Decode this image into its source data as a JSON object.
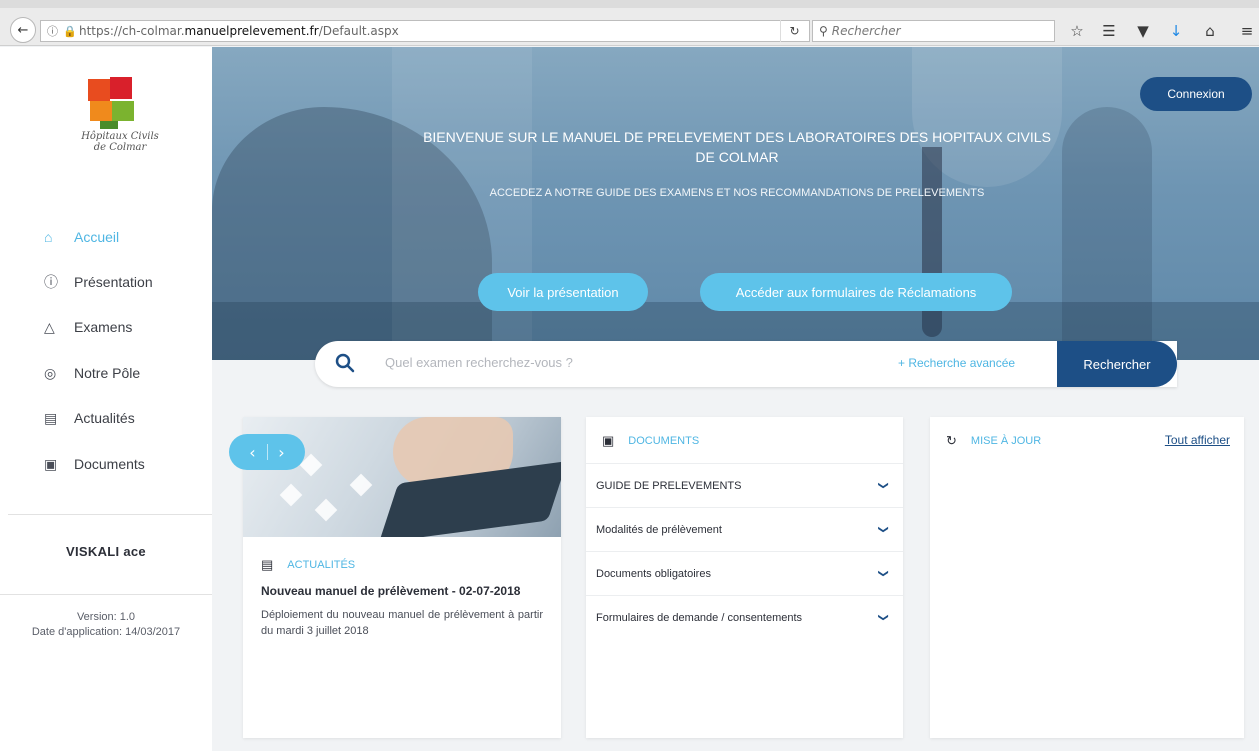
{
  "browser": {
    "url_prefix": "https://ch-colmar.",
    "url_domain": "manuelprelevement.fr",
    "url_path": "/Default.aspx",
    "search_placeholder": "Rechercher"
  },
  "sidebar": {
    "logo_text": "Hôpitaux Civils de Colmar",
    "items": [
      {
        "label": "Accueil",
        "icon": "home-icon",
        "active": true
      },
      {
        "label": "Présentation",
        "icon": "question-circle-icon",
        "active": false
      },
      {
        "label": "Examens",
        "icon": "flask-icon",
        "active": false
      },
      {
        "label": "Notre Pôle",
        "icon": "location-pin-icon",
        "active": false
      },
      {
        "label": "Actualités",
        "icon": "newspaper-icon",
        "active": false
      },
      {
        "label": "Documents",
        "icon": "document-icon",
        "active": false
      }
    ],
    "brand": "VISKALI ace",
    "version": "Version: 1.0",
    "date_application": "Date d'application: 14/03/2017"
  },
  "hero": {
    "connexion_label": "Connexion",
    "title": "BIENVENUE SUR LE MANUEL DE PRELEVEMENT DES LABORATOIRES DES HOPITAUX CIVILS DE COLMAR",
    "subtitle": "ACCEDEZ A NOTRE GUIDE DES EXAMENS ET NOS RECOMMANDATIONS DE PRELEVEMENTS",
    "btn_presentation": "Voir la présentation",
    "btn_reclamations": "Accéder aux formulaires de Réclamations"
  },
  "search": {
    "placeholder": "Quel examen recherchez-vous ?",
    "advanced_label": "+ Recherche avancée",
    "submit_label": "Rechercher"
  },
  "news": {
    "heading": "ACTUALITÉS",
    "title": "Nouveau manuel de prélèvement - 02-07-2018",
    "body": "Déploiement du nouveau manuel de prélèvement à partir du mardi 3 juillet 2018",
    "prev": "‹",
    "next": "›"
  },
  "documents": {
    "heading": "DOCUMENTS",
    "rows": [
      "GUIDE DE PRELEVEMENTS",
      "Modalités de prélèvement",
      "Documents obligatoires",
      "Formulaires de demande / consentements"
    ]
  },
  "updates": {
    "heading": "MISE À JOUR",
    "show_all": "Tout afficher"
  },
  "colors": {
    "accent": "#4fb6e3",
    "primary": "#1d4f86",
    "pill": "#5ec3ea"
  }
}
